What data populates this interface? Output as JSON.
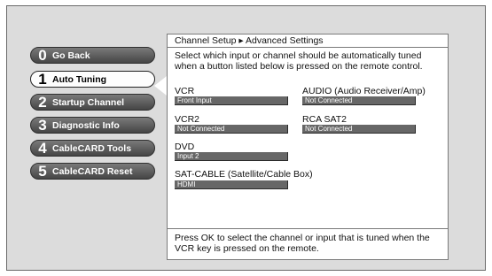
{
  "menu": {
    "items": [
      {
        "number": "0",
        "label": "Go Back"
      },
      {
        "number": "1",
        "label": "Auto Tuning"
      },
      {
        "number": "2",
        "label": "Startup Channel"
      },
      {
        "number": "3",
        "label": "Diagnostic Info"
      },
      {
        "number": "4",
        "label": "CableCARD Tools"
      },
      {
        "number": "5",
        "label": "CableCARD Reset"
      }
    ],
    "selected_index": 1
  },
  "panel": {
    "breadcrumb": "Channel Setup ▸ Advanced Settings",
    "instructions": "Select which input or channel should be automatically tuned when a button listed below is pressed on the remote control.",
    "devices": {
      "vcr": {
        "label": "VCR",
        "value": "Front Input"
      },
      "audio": {
        "label": "AUDIO (Audio Receiver/Amp)",
        "value": "Not Connected"
      },
      "vcr2": {
        "label": "VCR2",
        "value": "Not Connected"
      },
      "rca_sat2": {
        "label": "RCA SAT2",
        "value": "Not Connected"
      },
      "dvd": {
        "label": "DVD",
        "value": "Input 2"
      },
      "sat_cable": {
        "label": "SAT-CABLE (Satellite/Cable Box)",
        "value": "HDMI"
      }
    },
    "footer": "Press OK to select the channel or input that is tuned when the VCR key is pressed on the remote."
  },
  "colors": {
    "background": "#dcdcdc",
    "button": "#555555",
    "button_selected": "#ffffff",
    "value_box": "#676767"
  }
}
